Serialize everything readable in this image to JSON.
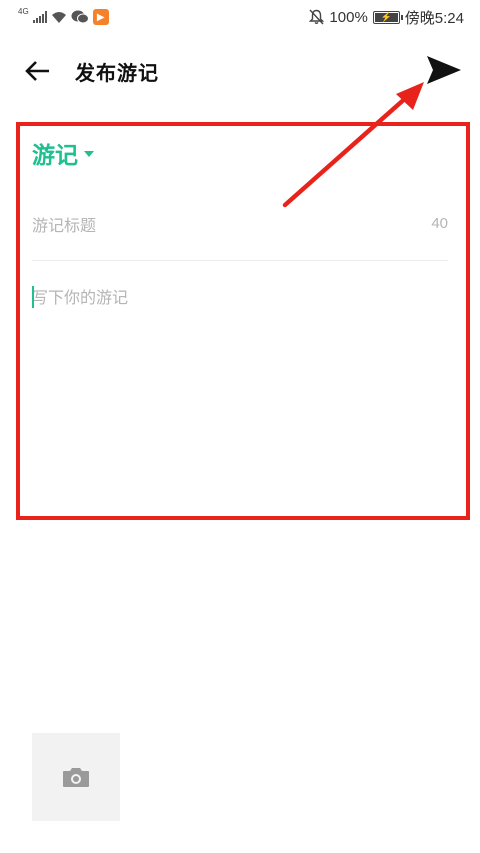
{
  "status_bar": {
    "network": "4G",
    "battery_percent": "100%",
    "time": "傍晚5:24"
  },
  "header": {
    "title": "发布游记",
    "back_icon": "arrow-left-icon",
    "send_icon": "send-icon"
  },
  "editor": {
    "category_label": "游记",
    "title_placeholder": "游记标题",
    "title_char_limit": "40",
    "body_placeholder": "写下你的游记"
  },
  "attachments": {
    "add_photo_icon": "camera-icon"
  },
  "colors": {
    "accent": "#1fbf8f",
    "annotation": "#e8231c"
  }
}
